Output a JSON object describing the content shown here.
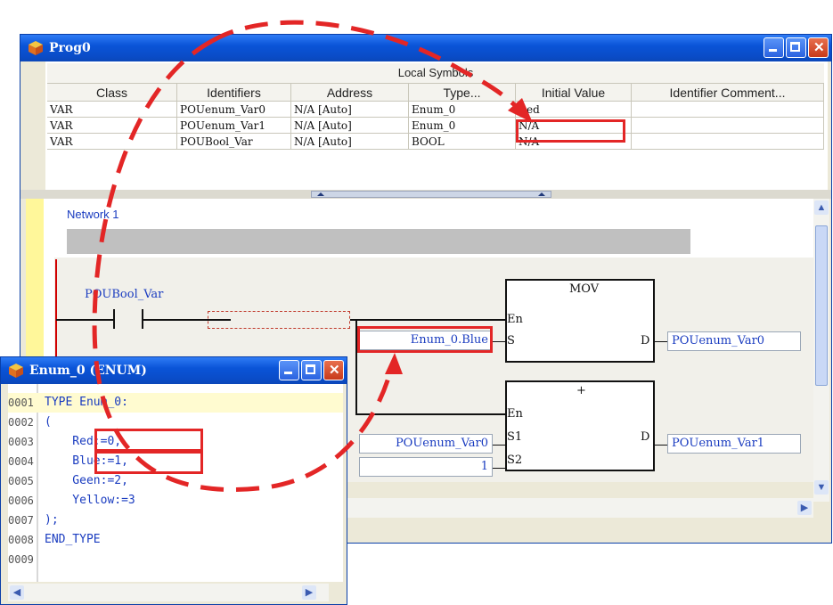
{
  "main_window": {
    "title": "Prog0",
    "symbols_header": "Local Symbols",
    "columns": [
      "Class",
      "Identifiers",
      "Address",
      "Type...",
      "Initial Value",
      "Identifier Comment..."
    ],
    "rows": [
      [
        "VAR",
        "POUenum_Var0",
        "N/A [Auto]",
        "Enum_0",
        "Red",
        ""
      ],
      [
        "VAR",
        "POUenum_Var1",
        "N/A [Auto]",
        "Enum_0",
        "N/A",
        ""
      ],
      [
        "VAR",
        "POUBool_Var",
        "N/A [Auto]",
        "BOOL",
        "N/A",
        ""
      ]
    ]
  },
  "ladder": {
    "network_title": "Network 1",
    "contact_label": "POUBool_Var",
    "mov_block": {
      "name": "MOV",
      "en": "En",
      "s": "S",
      "d": "D",
      "s_value": "Enum_0.Blue",
      "d_value": "POUenum_Var0"
    },
    "add_block": {
      "name": "+",
      "en": "En",
      "s1": "S1",
      "s2": "S2",
      "d": "D",
      "s1_value": "POUenum_Var0",
      "s2_value": "1",
      "d_value": "POUenum_Var1"
    }
  },
  "enum_window": {
    "title": "Enum_0 (ENUM)",
    "lines": [
      {
        "num": "0001",
        "text": "TYPE Enum_0:"
      },
      {
        "num": "0002",
        "text": "("
      },
      {
        "num": "0003",
        "text": "    Red:=0,"
      },
      {
        "num": "0004",
        "text": "    Blue:=1,"
      },
      {
        "num": "0005",
        "text": "    Geen:=2,"
      },
      {
        "num": "0006",
        "text": "    Yellow:=3"
      },
      {
        "num": "0007",
        "text": ");"
      },
      {
        "num": "0008",
        "text": "END_TYPE"
      },
      {
        "num": "0009",
        "text": ""
      }
    ]
  },
  "colors": {
    "highlight": "#e32626",
    "title_blue": "#0a54d8",
    "label_blue": "#1a3cc0"
  }
}
